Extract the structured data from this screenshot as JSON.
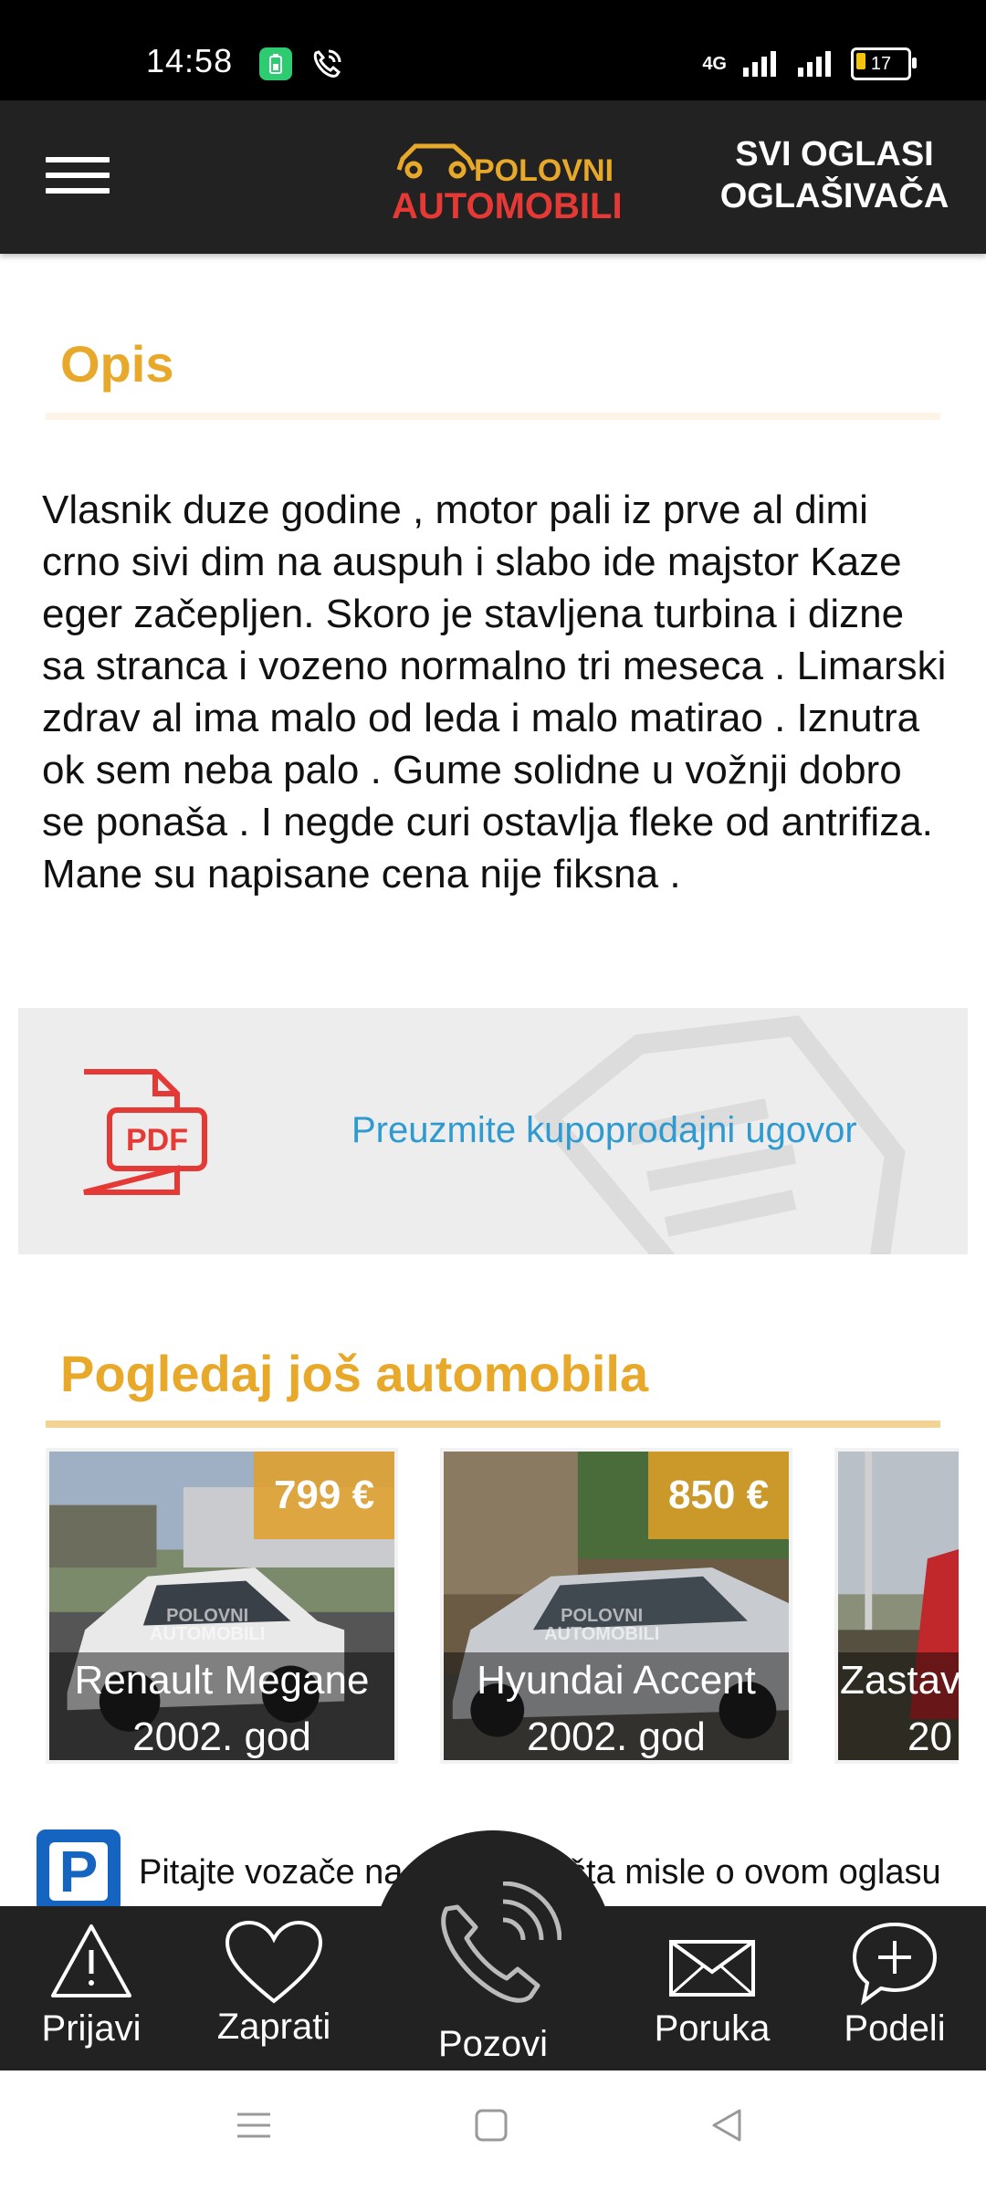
{
  "status_bar": {
    "time": "14:58",
    "network": "4G",
    "battery": "17"
  },
  "header": {
    "logo_line1": "POLOVNI",
    "logo_line2": "AUTOMOBILI",
    "all_ads_line1": "SVI OGLASI",
    "all_ads_line2": "OGLAŠIVAČA"
  },
  "description": {
    "title": "Opis",
    "text": "Vlasnik duze godine , motor pali iz prve al dimi crno sivi dim na auspuh i slabo ide majstor Kaze eger začepljen. Skoro je stavljena turbina i dizne sa stranca i vozeno normalno tri meseca . Limarski zdrav al ima malo od leda i malo matirao . Iznutra ok sem neba palo . Gume solidne u vožnji dobro se ponaša . I negde curi ostavlja fleke od antrifiza. Mane su napisane cena nije fiksna ."
  },
  "pdf": {
    "icon_label": "PDF",
    "link_text": "Preuzmite kupoprodajni ugovor"
  },
  "more_cars": {
    "title": "Pogledaj još automobila",
    "watermark_line1": "POLOVNI",
    "watermark_line2": "AUTOMOBILI",
    "cards": [
      {
        "price": "799 €",
        "model": "Renault Megane",
        "year": "2002. god"
      },
      {
        "price": "850 €",
        "model": "Hyundai Accent",
        "year": "2002. god"
      },
      {
        "price": "",
        "model": "Zastava",
        "year": "20"
      }
    ]
  },
  "ask_drivers": {
    "text": "Pitajte vozače na ParkUp-u šta misle o ovom oglasu",
    "icon_letter": "P"
  },
  "bottom_nav": {
    "report": "Prijavi",
    "follow": "Zaprati",
    "call": "Pozovi",
    "message": "Poruka",
    "share": "Podeli"
  },
  "colors": {
    "accent": "#e8a92a",
    "header_bg": "#222222",
    "link": "#2e9ad0",
    "pdf_red": "#e53935"
  }
}
